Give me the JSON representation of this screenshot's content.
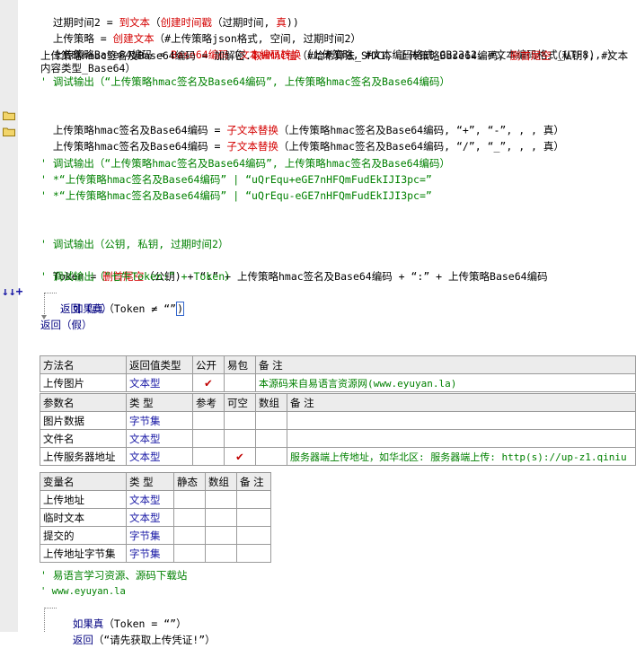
{
  "editor": {
    "lines": {
      "l1": {
        "a": "过期时间2 = ",
        "b": "到文本",
        "c": "（",
        "d": "创建时间戳",
        "e": "（过期时间, ",
        "f": "真",
        "g": "))"
      },
      "l2": {
        "a": "上传策略 = ",
        "b": "创建文本",
        "c": "（#上传策略json格式, 空间, 过期时间2）"
      },
      "l3": {
        "a": "上传策略Base64编码 = ",
        "b": "Base64编码",
        "c": "（",
        "d": "文本编码转换",
        "e": "（上传策略, #文本编码格式_GB2312, #文本编码格式_UTF8), ）"
      },
      "l4": {
        "a": "上传策略hmac签名及Base64编码 = 加解密.",
        "b": "取HMAC值",
        "c": "（#哈希算法_SHA1, 上传策略Base64编码, ",
        "d": "删首尾空",
        "e": "（私钥), #文本内容类型_Base64）"
      },
      "l5": "' 调试输出（“上传策略hmac签名及Base64编码”, 上传策略hmac签名及Base64编码）",
      "l6": {
        "a": "上传策略hmac签名及Base64编码 = ",
        "b": "子文本替换",
        "c": "（上传策略hmac签名及Base64编码, “+”, “-”, , , 真）"
      },
      "l7": {
        "a": "上传策略hmac签名及Base64编码 = ",
        "b": "子文本替换",
        "c": "（上传策略hmac签名及Base64编码, “/”, “_”, , , 真）"
      },
      "l8": "' 调试输出（“上传策略hmac签名及Base64编码”, 上传策略hmac签名及Base64编码）",
      "l9": "' *“上传策略hmac签名及Base64编码” | “uQrEqu+eGE7nHFQmFudEkIJI3pc=”",
      "l10": "' *“上传策略hmac签名及Base64编码” | “uQrEqu-eGE7nHFQmFudEkIJI3pc=”",
      "l11": "' 调试输出（公钥, 私钥, 过期时间2）",
      "l12": {
        "a": "Token = ",
        "b": "删首尾空",
        "c": "（公钥) + “:” + 上传策略hmac签名及Base64编码 + “:” + 上传策略Base64编码"
      },
      "l13": "' 调试输出（“七牛Token:” + Token）",
      "l14": {
        "a": "如果真",
        "b": "（",
        "c": "Token ≠ “”",
        "d": ")"
      },
      "l15": "返回（真）",
      "l16": "返回（假）"
    },
    "markers": "↓↓+"
  },
  "method_table": {
    "headers": [
      "方法名",
      "返回值类型",
      "公开",
      "易包",
      "备 注"
    ],
    "row": {
      "name": "上传图片",
      "ret": "文本型",
      "public": "✔",
      "pkg": "",
      "note": "本源码来自易语言资源网(www.eyuyan.la)"
    }
  },
  "param_table": {
    "headers": [
      "参数名",
      "类 型",
      "参考",
      "可空",
      "数组",
      "备 注"
    ],
    "rows": [
      {
        "name": "图片数据",
        "type": "字节集",
        "ref": "",
        "nullable": "",
        "arr": "",
        "note": ""
      },
      {
        "name": "文件名",
        "type": "文本型",
        "ref": "",
        "nullable": "",
        "arr": "",
        "note": ""
      },
      {
        "name": "上传服务器地址",
        "type": "文本型",
        "ref": "",
        "nullable": "✔",
        "arr": "",
        "note": "服务器端上传地址，如华北区: 服务器端上传: http(s)://up-z1.qiniu"
      }
    ]
  },
  "var_table": {
    "headers": [
      "变量名",
      "类 型",
      "静态",
      "数组",
      "备 注"
    ],
    "rows": [
      {
        "name": "上传地址",
        "type": "文本型"
      },
      {
        "name": "临时文本",
        "type": "文本型"
      },
      {
        "name": "提交的",
        "type": "字节集"
      },
      {
        "name": "上传地址字节集",
        "type": "字节集"
      }
    ]
  },
  "footer": {
    "c1": "' 易语言学习资源、源码下载站",
    "c2": "' www.eyuyan.la",
    "if2": {
      "a": "如果真",
      "b": "（Token = “”）"
    },
    "ret2": {
      "a": "返回",
      "b": "（“请先获取上传凭证!”）"
    }
  },
  "colors": {
    "function": "#d40000",
    "type": "#1a1aa6",
    "comment": "#008000",
    "gutter": "#ececec"
  }
}
